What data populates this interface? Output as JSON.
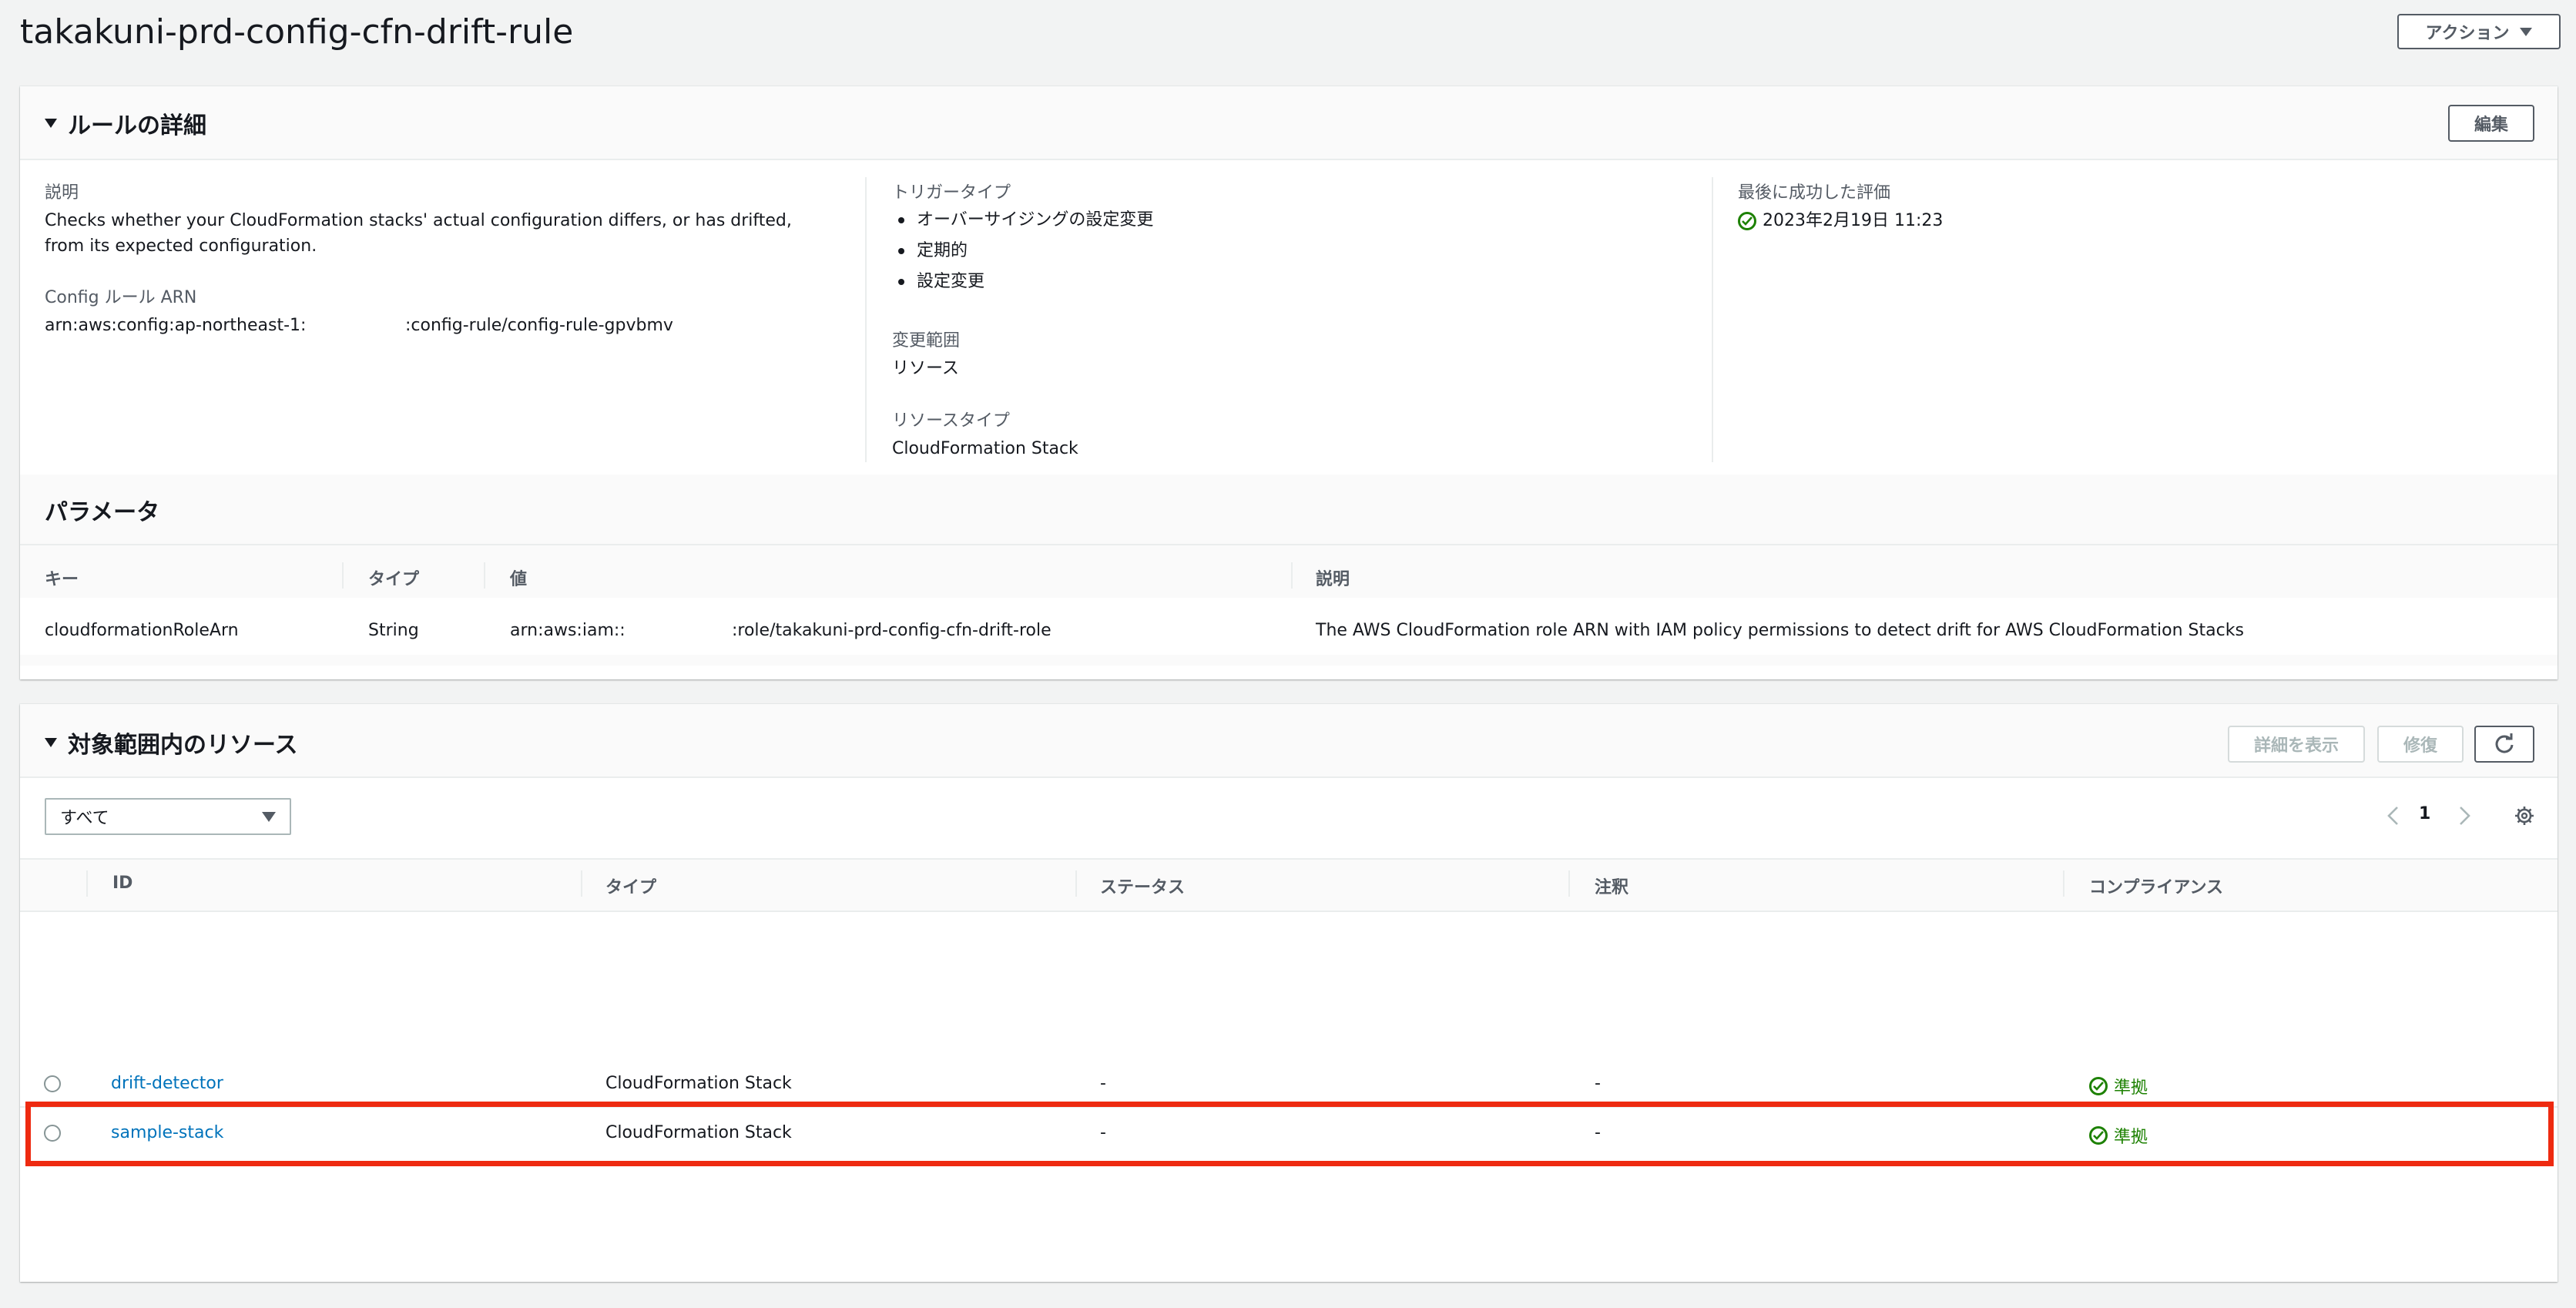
{
  "page": {
    "title": "takakuni-prd-config-cfn-drift-rule",
    "actions_label": "アクション"
  },
  "rule_details": {
    "title": "ルールの詳細",
    "edit_label": "編集",
    "description_label": "説明",
    "description_value": "Checks whether your CloudFormation stacks' actual configuration differs, or has drifted, from its expected configuration.",
    "arn_label": "Config ルール ARN",
    "arn_prefix": "arn:aws:config:ap-northeast-1:",
    "arn_suffix": ":config-rule/config-rule-gpvbmv",
    "trigger_type_label": "トリガータイプ",
    "trigger_types": [
      "オーバーサイジングの設定変更",
      "定期的",
      "設定変更"
    ],
    "scope_label": "変更範囲",
    "scope_value": "リソース",
    "resource_type_label": "リソースタイプ",
    "resource_type_value": "CloudFormation Stack",
    "last_eval_label": "最後に成功した評価",
    "last_eval_value": "2023年2月19日 11:23"
  },
  "parameters": {
    "title": "パラメータ",
    "columns": [
      "キー",
      "タイプ",
      "値",
      "説明"
    ],
    "row": {
      "key": "cloudformationRoleArn",
      "type": "String",
      "value_prefix": "arn:aws:iam::",
      "value_suffix": ":role/takakuni-prd-config-cfn-drift-role",
      "description": "The AWS CloudFormation role ARN with IAM policy permissions to detect drift for AWS CloudFormation Stacks"
    }
  },
  "resources": {
    "title": "対象範囲内のリソース",
    "details_label": "詳細を表示",
    "remediate_label": "修復",
    "filter_value": "すべて",
    "page_number": "1",
    "columns": [
      "ID",
      "タイプ",
      "ステータス",
      "注釈",
      "コンプライアンス"
    ],
    "rows": [
      {
        "id": "drift-detector",
        "type": "CloudFormation Stack",
        "status": "-",
        "annotation": "-",
        "compliance": "準拠"
      },
      {
        "id": "sample-stack",
        "type": "CloudFormation Stack",
        "status": "-",
        "annotation": "-",
        "compliance": "準拠"
      }
    ]
  },
  "colors": {
    "link": "#0073bb",
    "compliant": "#1d8102",
    "highlight": "#ee2a10"
  }
}
